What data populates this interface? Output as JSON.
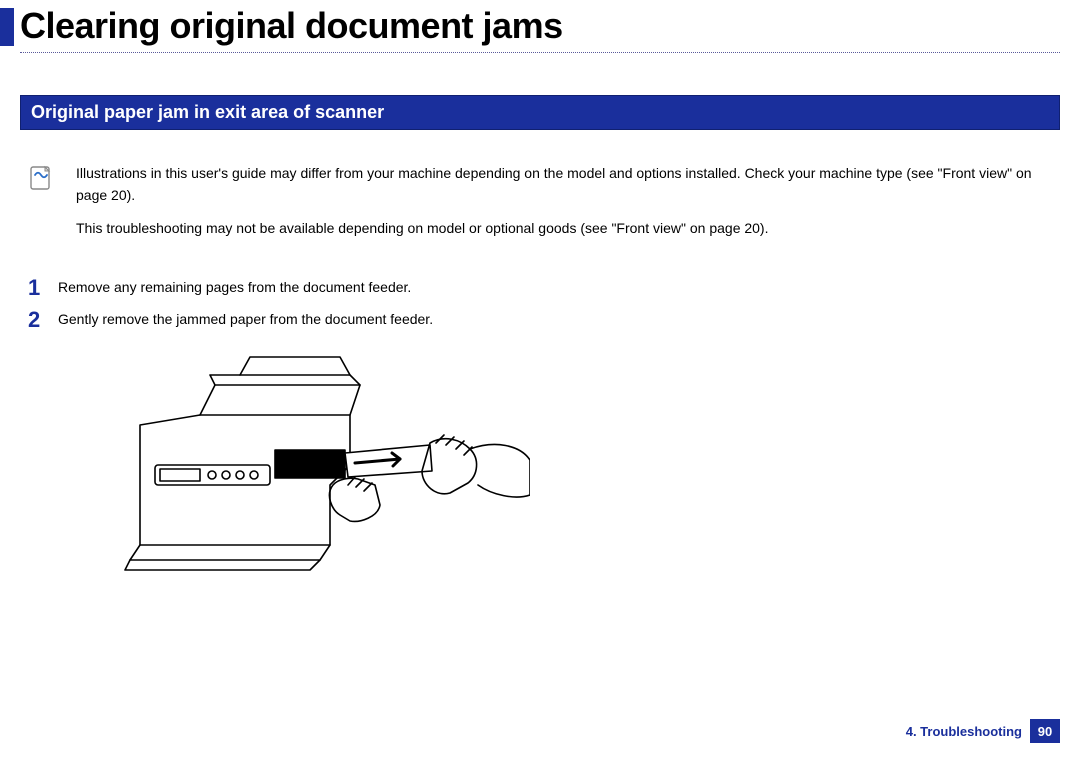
{
  "title": "Clearing original document jams",
  "section_heading": "Original paper jam in exit area of scanner",
  "notes": [
    "Illustrations in this user's guide may differ from your machine depending on the model and options installed. Check your machine type (see \"Front view\" on page 20).",
    "This troubleshooting may not be available depending on model or optional goods (see \"Front view\" on page 20)."
  ],
  "steps": [
    {
      "num": "1",
      "text": "Remove any remaining pages from the document feeder."
    },
    {
      "num": "2",
      "text": "Gently remove the jammed paper from the document feeder."
    }
  ],
  "footer": {
    "chapter": "4. Troubleshooting",
    "page": "90"
  }
}
